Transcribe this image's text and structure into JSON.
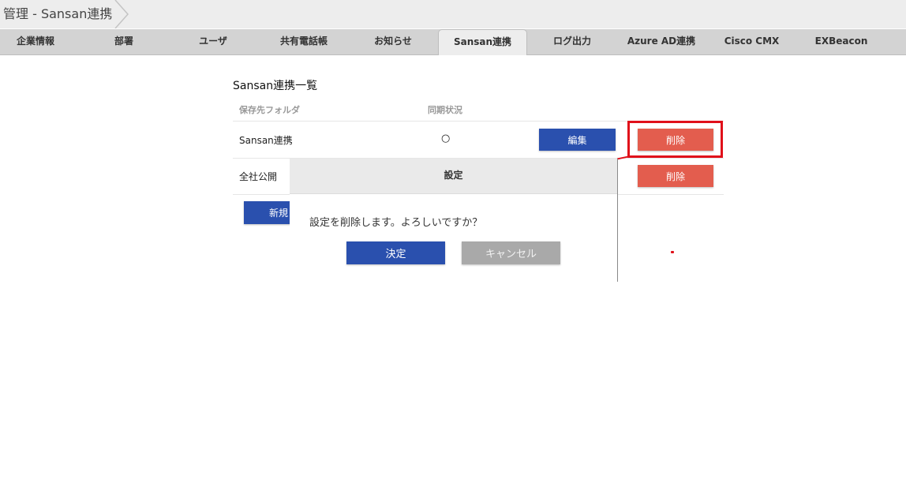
{
  "header": {
    "breadcrumb": "管理 - Sansan連携"
  },
  "tabs": [
    {
      "label": "企業情報",
      "active": false
    },
    {
      "label": "部署",
      "active": false
    },
    {
      "label": "ユーザ",
      "active": false
    },
    {
      "label": "共有電話帳",
      "active": false
    },
    {
      "label": "お知らせ",
      "active": false
    },
    {
      "label": "Sansan連携",
      "active": true
    },
    {
      "label": "ログ出力",
      "active": false
    },
    {
      "label": "Azure AD連携",
      "active": false
    },
    {
      "label": "Cisco CMX",
      "active": false
    },
    {
      "label": "EXBeacon",
      "active": false
    }
  ],
  "list": {
    "title": "Sansan連携一覧",
    "columns": [
      "保存先フォルダ",
      "同期状況"
    ],
    "rows": [
      {
        "folder": "Sansan連携",
        "status": "○",
        "edit_label": "編集",
        "delete_label": "削除"
      },
      {
        "folder": "全社公開",
        "status": "",
        "edit_label": "",
        "delete_label": "削除"
      }
    ],
    "new_button_label": "新規"
  },
  "dialog": {
    "title": "設定",
    "message": "設定を削除します。よろしいですか？",
    "confirm_label": "決定",
    "cancel_label": "キャンセル"
  },
  "colors": {
    "primary": "#2a50ae",
    "danger": "#e35d4e",
    "disabled": "#a9a9a9",
    "annotation": "#e0101a"
  }
}
